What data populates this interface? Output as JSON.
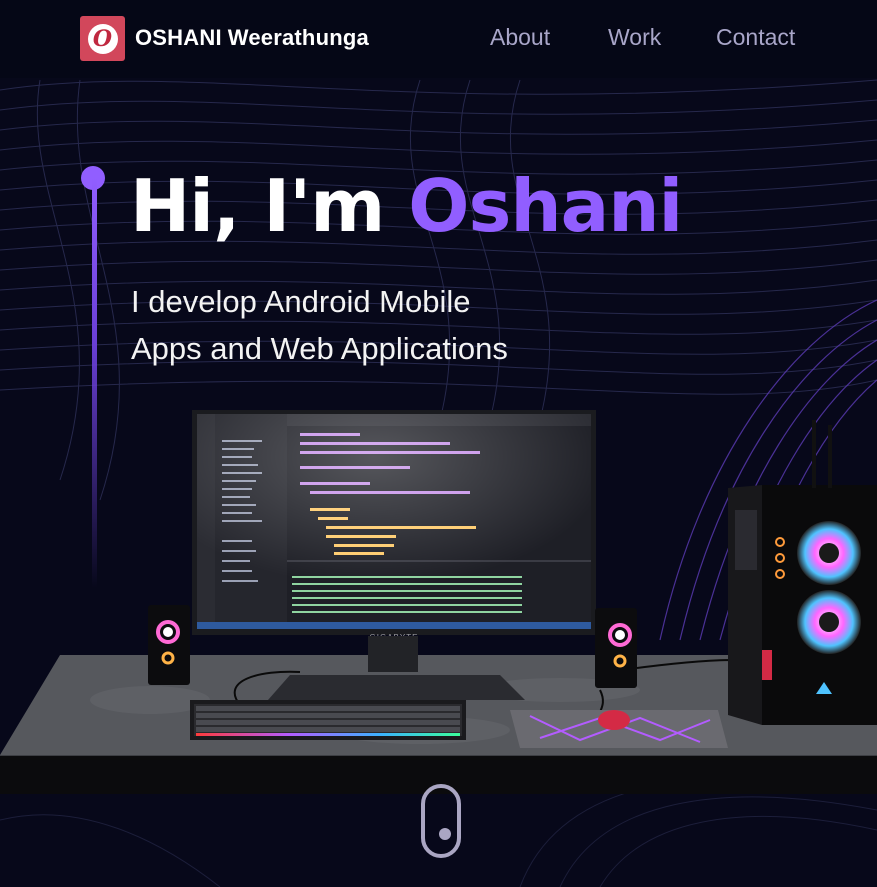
{
  "navbar": {
    "logo_letter": "O",
    "brand_first": "OSHANI",
    "brand_last": "Weerathunga",
    "links": [
      "About",
      "Work",
      "Contact"
    ]
  },
  "hero": {
    "greeting": "Hi, I'm ",
    "name": "Oshani",
    "subtitle_line1": "I develop Android Mobile",
    "subtitle_line2": "Apps and Web Applications"
  },
  "scene": {
    "monitor_brand": "GIGABYTE"
  },
  "colors": {
    "accent": "#915eff",
    "background": "#07081a",
    "logo": "#d2475b",
    "nav_link": "#a9a6c9"
  }
}
